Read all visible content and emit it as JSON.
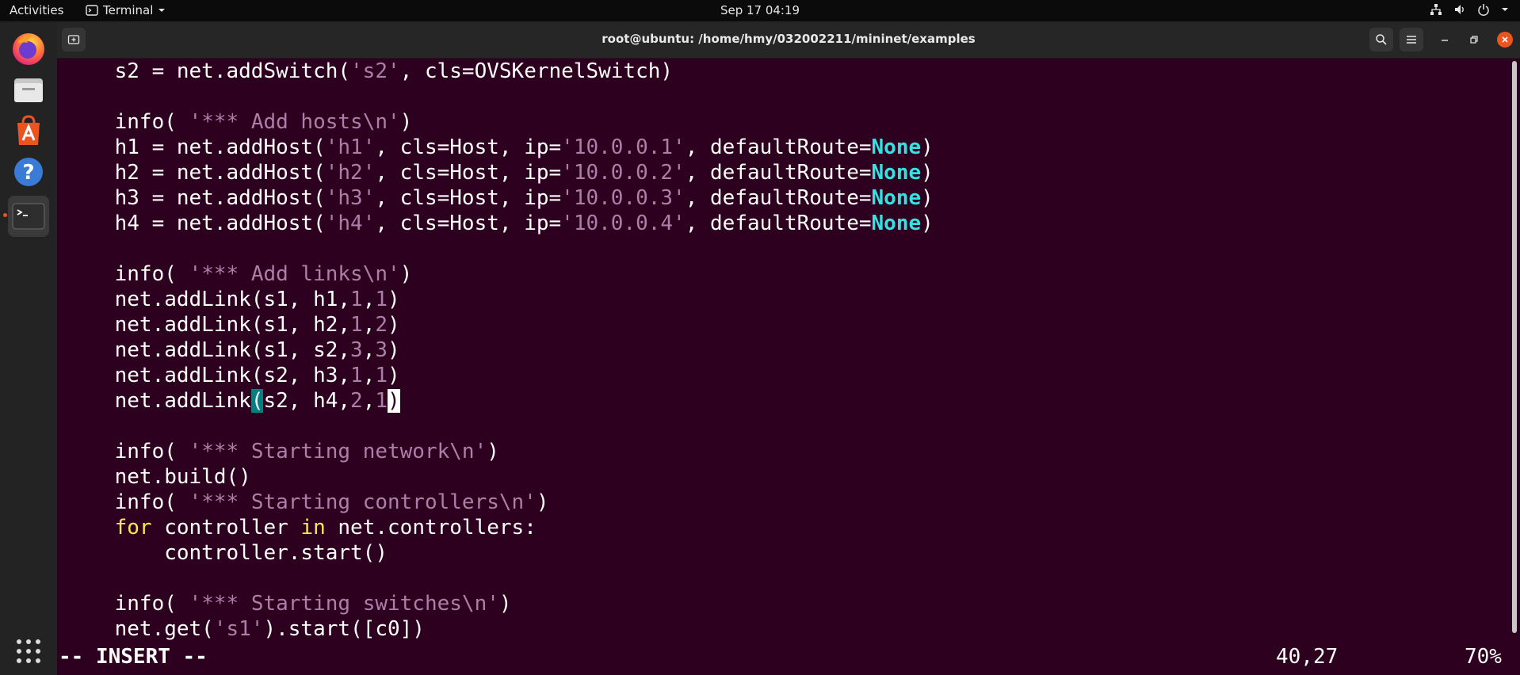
{
  "topbar": {
    "activities": "Activities",
    "app_name": "Terminal",
    "datetime": "Sep 17  04:19"
  },
  "window": {
    "title": "root@ubuntu: /home/hmy/032002211/mininet/examples"
  },
  "editor": {
    "lines": [
      [
        {
          "t": "    s2 = net.addSwitch("
        },
        {
          "t": "'s2'",
          "c": "s"
        },
        {
          "t": ", cls=OVSKernelSwitch)"
        }
      ],
      [],
      [
        {
          "t": "    info( "
        },
        {
          "t": "'*** Add hosts\\n'",
          "c": "s"
        },
        {
          "t": ")"
        }
      ],
      [
        {
          "t": "    h1 = net.addHost("
        },
        {
          "t": "'h1'",
          "c": "s"
        },
        {
          "t": ", cls=Host, ip="
        },
        {
          "t": "'10.0.0.1'",
          "c": "s"
        },
        {
          "t": ", defaultRoute="
        },
        {
          "t": "None",
          "c": "c"
        },
        {
          "t": ")"
        }
      ],
      [
        {
          "t": "    h2 = net.addHost("
        },
        {
          "t": "'h2'",
          "c": "s"
        },
        {
          "t": ", cls=Host, ip="
        },
        {
          "t": "'10.0.0.2'",
          "c": "s"
        },
        {
          "t": ", defaultRoute="
        },
        {
          "t": "None",
          "c": "c"
        },
        {
          "t": ")"
        }
      ],
      [
        {
          "t": "    h3 = net.addHost("
        },
        {
          "t": "'h3'",
          "c": "s"
        },
        {
          "t": ", cls=Host, ip="
        },
        {
          "t": "'10.0.0.3'",
          "c": "s"
        },
        {
          "t": ", defaultRoute="
        },
        {
          "t": "None",
          "c": "c"
        },
        {
          "t": ")"
        }
      ],
      [
        {
          "t": "    h4 = net.addHost("
        },
        {
          "t": "'h4'",
          "c": "s"
        },
        {
          "t": ", cls=Host, ip="
        },
        {
          "t": "'10.0.0.4'",
          "c": "s"
        },
        {
          "t": ", defaultRoute="
        },
        {
          "t": "None",
          "c": "c"
        },
        {
          "t": ")"
        }
      ],
      [],
      [
        {
          "t": "    info( "
        },
        {
          "t": "'*** Add links\\n'",
          "c": "s"
        },
        {
          "t": ")"
        }
      ],
      [
        {
          "t": "    net.addLink(s1, h1,"
        },
        {
          "t": "1",
          "c": "n"
        },
        {
          "t": ","
        },
        {
          "t": "1",
          "c": "n"
        },
        {
          "t": ")"
        }
      ],
      [
        {
          "t": "    net.addLink(s1, h2,"
        },
        {
          "t": "1",
          "c": "n"
        },
        {
          "t": ","
        },
        {
          "t": "2",
          "c": "n"
        },
        {
          "t": ")"
        }
      ],
      [
        {
          "t": "    net.addLink(s1, s2,"
        },
        {
          "t": "3",
          "c": "n"
        },
        {
          "t": ","
        },
        {
          "t": "3",
          "c": "n"
        },
        {
          "t": ")"
        }
      ],
      [
        {
          "t": "    net.addLink(s2, h3,"
        },
        {
          "t": "1",
          "c": "n"
        },
        {
          "t": ","
        },
        {
          "t": "1",
          "c": "n"
        },
        {
          "t": ")"
        }
      ],
      [
        {
          "t": "    net.addLink"
        },
        {
          "t": "(",
          "c": "mb"
        },
        {
          "t": "s2, h4,"
        },
        {
          "t": "2",
          "c": "n"
        },
        {
          "t": ","
        },
        {
          "t": "1",
          "c": "n"
        },
        {
          "t": ")",
          "c": "cur"
        }
      ],
      [],
      [
        {
          "t": "    info( "
        },
        {
          "t": "'*** Starting network\\n'",
          "c": "s"
        },
        {
          "t": ")"
        }
      ],
      [
        {
          "t": "    net.build()"
        }
      ],
      [
        {
          "t": "    info( "
        },
        {
          "t": "'*** Starting controllers\\n'",
          "c": "s"
        },
        {
          "t": ")"
        }
      ],
      [
        {
          "t": "    "
        },
        {
          "t": "for",
          "c": "k"
        },
        {
          "t": " controller "
        },
        {
          "t": "in",
          "c": "k"
        },
        {
          "t": " net.controllers:"
        }
      ],
      [
        {
          "t": "        controller.start()"
        }
      ],
      [],
      [
        {
          "t": "    info( "
        },
        {
          "t": "'*** Starting switches\\n'",
          "c": "s"
        },
        {
          "t": ")"
        }
      ],
      [
        {
          "t": "    net.get("
        },
        {
          "t": "'s1'",
          "c": "s"
        },
        {
          "t": ").start([c0])"
        }
      ]
    ],
    "mode": "-- INSERT --",
    "cursor_position": "40,27",
    "scroll_percent": "70%"
  },
  "colors": {
    "terminal_bg": "#2c001e",
    "string": "#ad7fa8",
    "keyword": "#fce94f",
    "constant": "#34e2e2",
    "accent": "#e95420"
  },
  "icons": {
    "dock": [
      "firefox-icon",
      "files-icon",
      "software-icon",
      "help-icon",
      "terminal-icon",
      "apps-grid-icon"
    ],
    "tray": [
      "network-icon",
      "volume-icon",
      "power-icon"
    ]
  }
}
